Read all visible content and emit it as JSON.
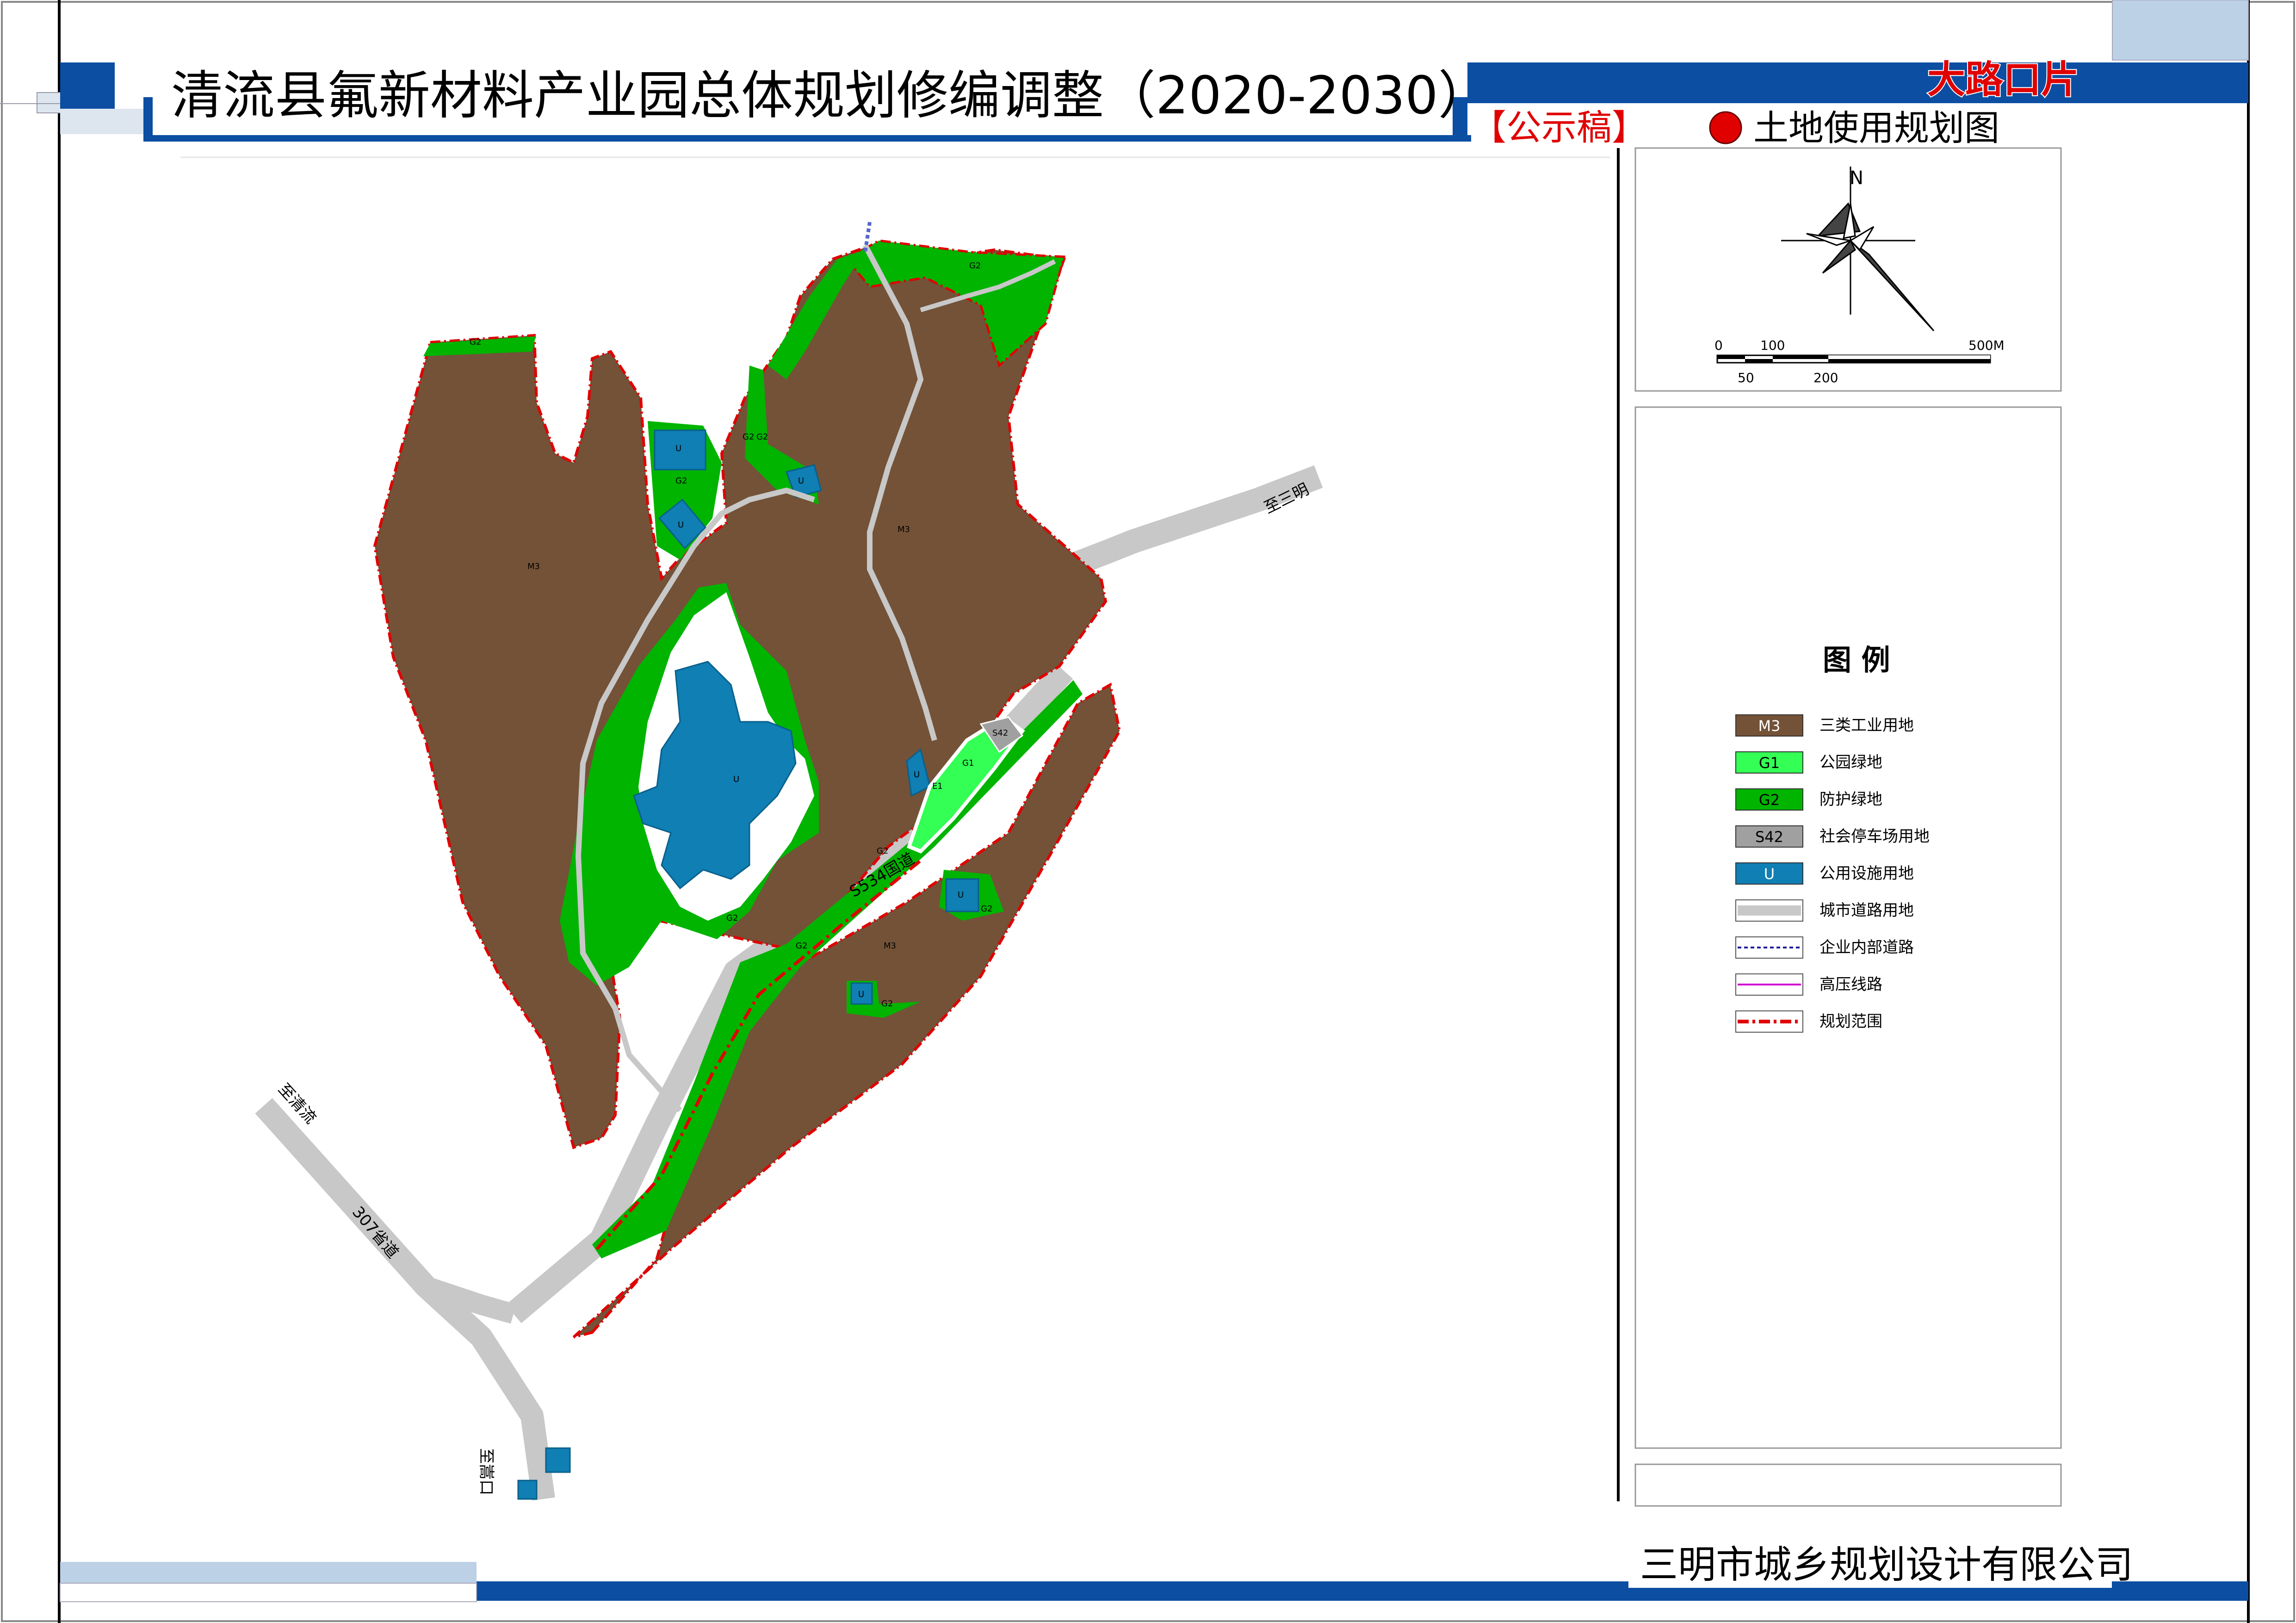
{
  "header": {
    "title": "清流县氟新材料产业园总体规划修编调整（2020-2030）",
    "section": "大路口片",
    "status": "【公示稿】",
    "map_name": "土地使用规划图"
  },
  "footer": {
    "company": "三明市城乡规划设计有限公司"
  },
  "compass": {
    "north": "N"
  },
  "scale_bar": {
    "top_labels": [
      "0",
      "100",
      "500M"
    ],
    "bottom_labels": [
      "50",
      "200"
    ]
  },
  "legend": {
    "title": "图 例",
    "items": [
      {
        "code": "M3",
        "label": "三类工业用地",
        "color": "#735238"
      },
      {
        "code": "G1",
        "label": "公园绿地",
        "color": "#33ff55"
      },
      {
        "code": "G2",
        "label": "防护绿地",
        "color": "#00b400"
      },
      {
        "code": "S42",
        "label": "社会停车场用地",
        "color": "#a0a0a0"
      },
      {
        "code": "U",
        "label": "公用设施用地",
        "color": "#0f7fb4"
      },
      {
        "code": "",
        "label": "城市道路用地",
        "color": "#c8c8c8"
      },
      {
        "code": "",
        "label": "企业内部道路",
        "color": "#1a1aa0"
      },
      {
        "code": "",
        "label": "高压线路",
        "color": "#d000d0"
      },
      {
        "code": "",
        "label": "规划范围",
        "color": "#e00000"
      }
    ]
  },
  "map": {
    "road_labels": {
      "to_sanming": "至三明",
      "to_qingliu": "至清流",
      "to_songkou": "至嵩口",
      "road_s534": "S534国道",
      "road_307": "307省道"
    },
    "parcel_labels": {
      "m3": "M3",
      "g2": "G2",
      "g1": "G1",
      "u": "U",
      "s42": "S42",
      "e1": "E1"
    }
  },
  "colors": {
    "frame_blue": "#0b4ea2",
    "frame_light": "#bcd0e6",
    "title_red": "#e00000",
    "industrial": "#735238",
    "park_green": "#33ff55",
    "buffer_green": "#00b400",
    "utility_blue": "#0f7fb4",
    "road_gray": "#c8c8c8",
    "boundary_red": "#e00000"
  }
}
